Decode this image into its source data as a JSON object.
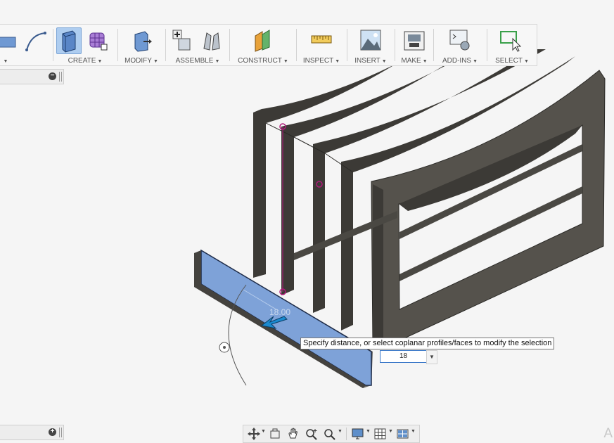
{
  "window": {
    "new_tab_glyph": "+"
  },
  "toolbar": {
    "groups": [
      {
        "label": "CREATE",
        "icons": [
          "extrude-icon",
          "form-icon"
        ]
      },
      {
        "label": "MODIFY",
        "icons": [
          "press-pull-icon"
        ]
      },
      {
        "label": "ASSEMBLE",
        "icons": [
          "new-component-icon",
          "joint-icon"
        ]
      },
      {
        "label": "CONSTRUCT",
        "icons": [
          "offset-plane-icon"
        ]
      },
      {
        "label": "INSPECT",
        "icons": [
          "measure-icon"
        ]
      },
      {
        "label": "INSERT",
        "icons": [
          "insert-image-icon"
        ]
      },
      {
        "label": "MAKE",
        "icons": [
          "3d-print-icon"
        ]
      },
      {
        "label": "ADD-INS",
        "icons": [
          "scripts-icon"
        ]
      },
      {
        "label": "SELECT",
        "icons": [
          "select-icon"
        ]
      }
    ],
    "sketch_icons": [
      "rectangle-icon",
      "spline-icon"
    ],
    "active_icon": "extrude-icon"
  },
  "panels": {
    "browser_collapse_glyph": "−",
    "comments_expand_glyph": "+"
  },
  "extrude": {
    "distance_label": "18.00",
    "tooltip": "Specify distance, or select coplanar profiles/faces to modify the selection",
    "distance_value": "18"
  },
  "navbar": {
    "icons": [
      "orbit-icon",
      "look-at-icon",
      "pan-icon",
      "zoom-icon",
      "fit-icon",
      "display-settings-icon",
      "grid-settings-icon",
      "viewports-icon"
    ]
  },
  "corner_glyph": "A",
  "colors": {
    "frame_dark": "#3c3a36",
    "frame_face": "#55524c",
    "selected_face": "#7ea2d8",
    "accent_blue": "#1b8ad0",
    "sketch_magenta": "#b0197a"
  }
}
